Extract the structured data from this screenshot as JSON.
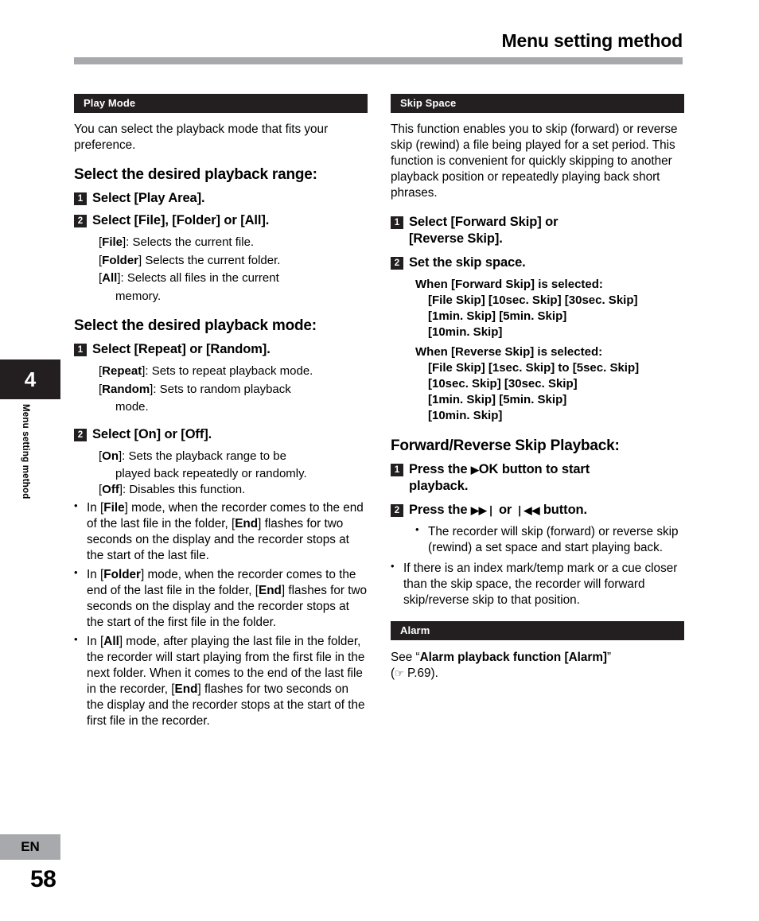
{
  "header": {
    "title": "Menu setting method"
  },
  "sidebar": {
    "chapter_number": "4",
    "vertical_label": "Menu setting method"
  },
  "footer": {
    "language": "EN",
    "page_number": "58"
  },
  "left_column": {
    "section_title": "Play Mode",
    "intro": "You can select the playback mode that fits your preference.",
    "heading_range": "Select the desired playback range:",
    "step1_num": "1",
    "step1_pre": "Select [",
    "step1_bold": "Play Area",
    "step1_post": "].",
    "step2_num": "2",
    "step2_text": "Select [File], [Folder] or [All].",
    "opt_file_key": "File",
    "opt_file_desc": "]: Selects the current file.",
    "opt_folder_key": "Folder",
    "opt_folder_desc": "] Selects the current folder.",
    "opt_all_key": "All",
    "opt_all_desc": "]: Selects all files in the current",
    "opt_all_desc2": "memory.",
    "heading_mode": "Select the desired playback mode:",
    "mode_step1_num": "1",
    "mode_step1_text": "Select [Repeat] or [Random].",
    "opt_repeat_key": "Repeat",
    "opt_repeat_desc": "]: Sets to repeat playback mode.",
    "opt_random_key": "Random",
    "opt_random_desc": "]: Sets to random playback",
    "opt_random_desc2": "mode.",
    "mode_step2_num": "2",
    "mode_step2_text": "Select [On] or [Off].",
    "opt_on_key": "On",
    "opt_on_desc": "]: Sets the playback range to be",
    "opt_on_desc2": "played back repeatedly or randomly.",
    "opt_off_key": "Off",
    "opt_off_desc": "]: Disables this function.",
    "bullet1": "In [File] mode, when the recorder comes to the end of the last file in the folder, [End] flashes for two seconds on the display and the recorder stops at the start of the last file.",
    "bullet2": "In [Folder] mode, when the recorder comes to the end of the last file in the folder, [End] flashes for two seconds on the display and the recorder stops at the start of the first file in the folder.",
    "bullet3": "In [All] mode, after playing the last file in the folder, the recorder will start playing from the first file in the next folder. When it comes to the end of the last file in the recorder, [End] flashes for two seconds on the display and the recorder stops at the start of the first file in the recorder."
  },
  "right_column": {
    "section_title": "Skip Space",
    "intro": "This function enables you to skip (forward) or reverse skip (rewind) a file being played for a set period. This function is convenient for quickly skipping to another playback position or repeatedly playing back short phrases.",
    "step1_num": "1",
    "step1_line1": "Select [Forward Skip] or",
    "step1_line2": "[Reverse Skip].",
    "step2_num": "2",
    "step2_text": "Set the skip space.",
    "forward_label": "When [Forward Skip] is selected:",
    "forward_line1": "[File Skip] [10sec. Skip] [30sec. Skip]",
    "forward_line2": "[1min. Skip] [5min. Skip]",
    "forward_line3": "[10min. Skip]",
    "reverse_label": "When [Reverse Skip] is selected:",
    "reverse_line1": "[File Skip] [1sec. Skip] to [5sec. Skip]",
    "reverse_line2": "[10sec. Skip] [30sec. Skip]",
    "reverse_line3": "[1min. Skip] [5min. Skip]",
    "reverse_line4": "[10min. Skip]",
    "heading_playback": "Forward/Reverse Skip Playback:",
    "pb_step1_num": "1",
    "pb_step1_line1_a": "Press the",
    "pb_step1_glyph": "▶",
    "pb_step1_line1_b": "OK button to start",
    "pb_step1_line2": "playback.",
    "pb_step2_num": "2",
    "pb_step2_a": "Press the",
    "pb_step2_glyph1": "▶▶❘",
    "pb_step2_b": "or",
    "pb_step2_glyph2": "❘◀◀",
    "pb_step2_c": "button.",
    "pb_bullet1": "The recorder will skip (forward) or reverse skip (rewind) a set space and start playing back.",
    "pb_bullet2": "If there is an index mark/temp mark or a cue closer than the skip space, the recorder will forward skip/reverse skip to that position.",
    "alarm_section_title": "Alarm",
    "alarm_pre": "See “",
    "alarm_bold": "Alarm playback function [Alarm]",
    "alarm_post": "”",
    "alarm_ref_glyph": "☞",
    "alarm_ref": " P.69)."
  }
}
